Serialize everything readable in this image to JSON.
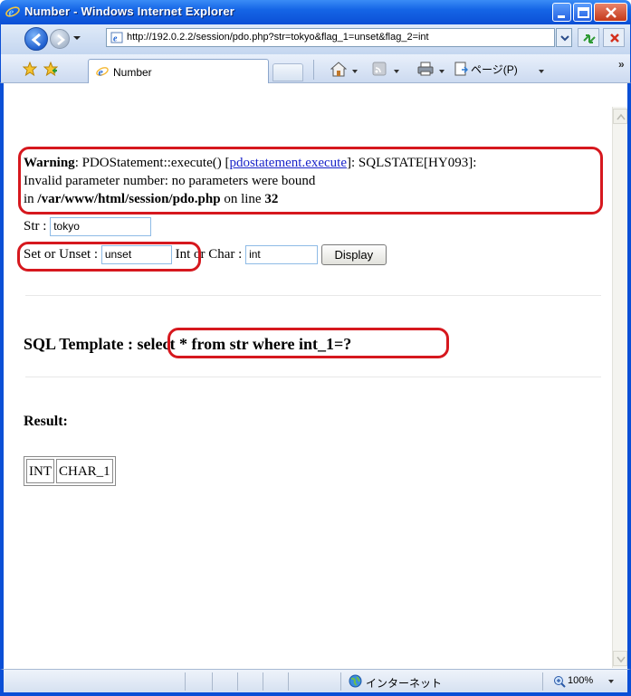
{
  "window": {
    "title": "Number - Windows Internet Explorer"
  },
  "address_bar": {
    "url": "http://192.0.2.2/session/pdo.php?str=tokyo&flag_1=unset&flag_2=int"
  },
  "tabs": [
    {
      "label": "Number"
    }
  ],
  "command_bar": {
    "page_menu_label": "ページ(P)"
  },
  "page": {
    "warning": {
      "label": "Warning",
      "text_before_link": ": PDOStatement::execute() [",
      "link_text": "pdostatement.execute",
      "text_after_link": "]: SQLSTATE[HY093]:",
      "line2": "Invalid parameter number: no parameters were bound",
      "line3_prefix": "in ",
      "path": "/var/www/html/session/pdo.php",
      "line3_middle": " on line ",
      "line_number": "32"
    },
    "form": {
      "str_label": "Str : ",
      "str_value": "tokyo",
      "set_label": "Set or Unset : ",
      "set_value": "unset",
      "int_label": "Int or Char : ",
      "int_value": "int",
      "display_button": "Display"
    },
    "sql_template": {
      "label": "SQL Template : ",
      "query": "select * from str where int_1=?"
    },
    "result": {
      "label": "Result:",
      "columns": [
        "INT",
        "CHAR_1"
      ]
    }
  },
  "status_bar": {
    "zone": "インターネット",
    "zoom": "100%"
  },
  "colors": {
    "highlight": "#d6181e",
    "titlebar": "#0b4fd6",
    "link": "#1a25c9"
  }
}
